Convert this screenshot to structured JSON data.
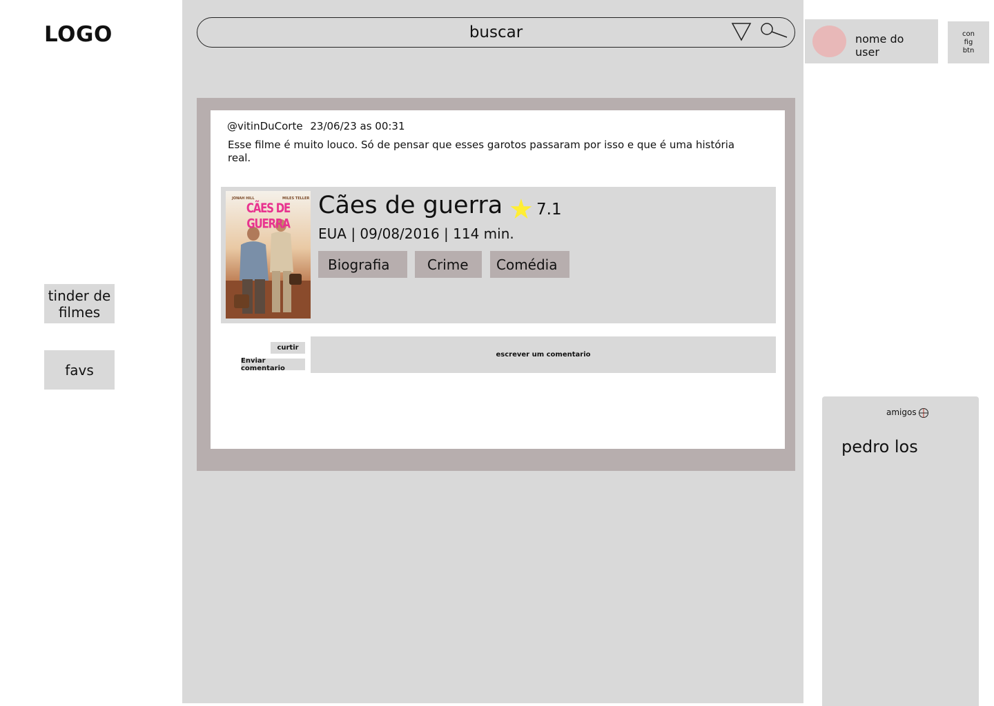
{
  "logo": {
    "text": "LOGO"
  },
  "sidebar": {
    "items": [
      {
        "label": "tinder de filmes"
      },
      {
        "label": "favs"
      }
    ]
  },
  "search": {
    "placeholder": "buscar",
    "filter_icon": "triangle-down-icon",
    "search_icon": "search-icon"
  },
  "user": {
    "name": "nome do user",
    "config_label": "con fig btn"
  },
  "post": {
    "author": "@vitinDuCorte",
    "datetime": "23/06/23 as 00:31",
    "text": "Esse filme é muito louco. Só de pensar que esses garotos passaram por isso e que é uma história real.",
    "movie": {
      "title": "Cães de guerra",
      "rating": "7.1",
      "info": "EUA | 09/08/2016 | 114 min.",
      "genres": [
        "Biografia",
        "Crime",
        "Comédia"
      ],
      "poster": {
        "top_left_name": "JONAH HILL",
        "top_right_name": "MILES TELLER",
        "title": "CÃES DE GUERRA"
      }
    },
    "like_label": "curtir",
    "send_comment_label": "Enviar comentario",
    "comment_placeholder": "escrever um comentario"
  },
  "friends": {
    "title": "amigos",
    "items": [
      {
        "name": "pedro los"
      }
    ]
  },
  "colors": {
    "panel_gray": "#d9d9d9",
    "frame_mauve": "#b7aeae",
    "avatar_pink": "#e8b8b8",
    "star_yellow": "#ffee33",
    "poster_title_pink": "#e8338f"
  }
}
